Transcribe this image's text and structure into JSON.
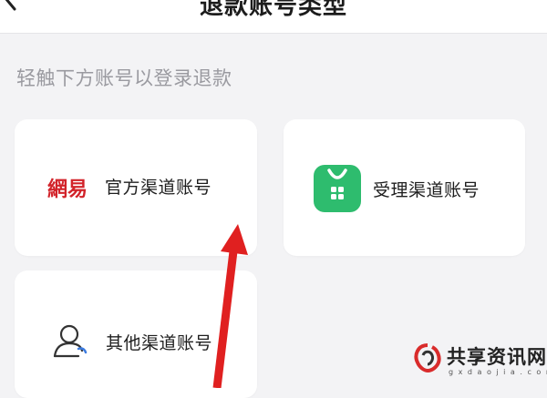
{
  "header": {
    "title": "退款账号类型"
  },
  "hint": "轻触下方账号以登录退款",
  "options": [
    {
      "label": "官方渠道账号",
      "icon": "netease-logo",
      "brand_text": "網易"
    },
    {
      "label": "受理渠道账号",
      "icon": "app-store-bag-icon"
    },
    {
      "label": "其他渠道账号",
      "icon": "user-icon"
    }
  ],
  "colors": {
    "accent_green": "#2ebc6e",
    "brand_red": "#d2232a",
    "arrow_red": "#e02020"
  },
  "watermark": {
    "text": "共享资讯网",
    "url": "g x d a o j i a . c o m"
  }
}
